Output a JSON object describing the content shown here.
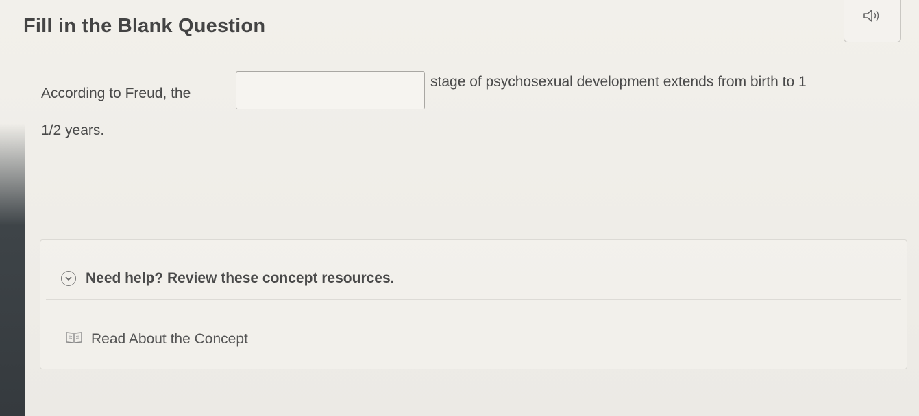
{
  "header": {
    "title": "Fill in the Blank Question",
    "audio_icon": "speaker-icon"
  },
  "question": {
    "text_before": "According to Freud, the",
    "blank_value": "",
    "text_after": "stage of psychosexual development extends from birth to 1",
    "text_continued": "1/2 years."
  },
  "help": {
    "toggle_icon": "chevron-down-icon",
    "header_label": "Need help? Review these concept resources.",
    "resources": [
      {
        "icon": "book-icon",
        "label": "Read About the Concept"
      }
    ]
  }
}
